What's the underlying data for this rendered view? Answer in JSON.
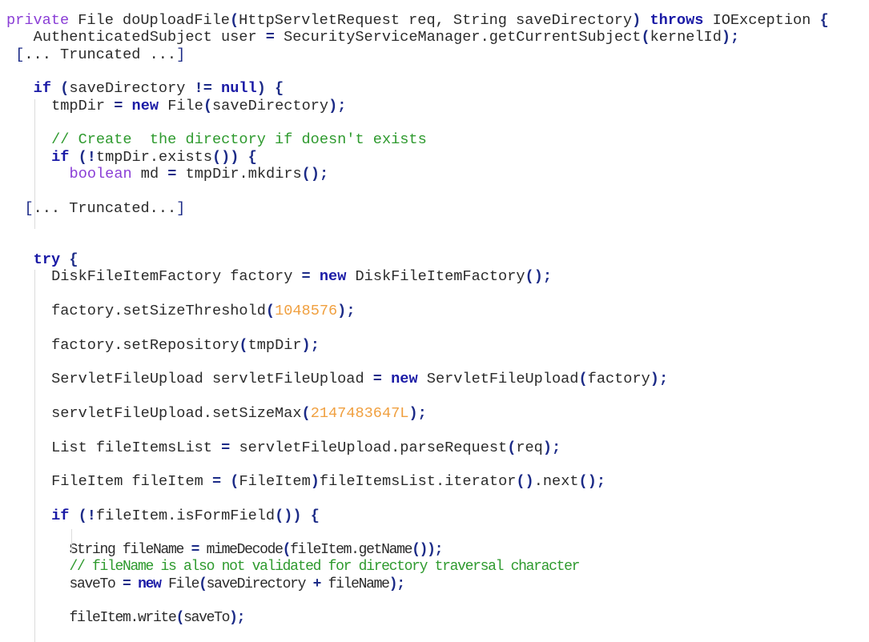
{
  "editor": {
    "language": "java",
    "colors": {
      "keyword": "#1a1aa6",
      "modifier": "#8a3ed6",
      "comment": "#2e9a2e",
      "number": "#f0a040",
      "punctuation": "#1c2b87",
      "text": "#2b2b2b",
      "background": "#ffffff"
    },
    "lines": [
      {
        "indent": 0,
        "tokens": [
          [
            "mod",
            "private"
          ],
          [
            "plain",
            " File doUploadFile"
          ],
          [
            "punc",
            "("
          ],
          [
            "plain",
            "HttpServletRequest req, String saveDirectory"
          ],
          [
            "punc",
            ")"
          ],
          [
            "plain",
            " "
          ],
          [
            "kw",
            "throws"
          ],
          [
            "plain",
            " IOException "
          ],
          [
            "punc",
            "{"
          ]
        ]
      },
      {
        "indent": 3,
        "tokens": [
          [
            "plain",
            "AuthenticatedSubject user "
          ],
          [
            "punc",
            "="
          ],
          [
            "plain",
            " SecurityServiceManager.getCurrentSubject"
          ],
          [
            "punc",
            "("
          ],
          [
            "plain",
            "kernelId"
          ],
          [
            "punc",
            ")"
          ],
          [
            "punc",
            ";"
          ]
        ]
      },
      {
        "indent": 1,
        "tokens": [
          [
            "trunc",
            "["
          ],
          [
            "plain",
            "... Truncated ..."
          ],
          [
            "trunc",
            "]"
          ]
        ]
      },
      {
        "indent": 0,
        "tokens": []
      },
      {
        "indent": 3,
        "tokens": [
          [
            "kw",
            "if"
          ],
          [
            "plain",
            " "
          ],
          [
            "punc",
            "("
          ],
          [
            "plain",
            "saveDirectory "
          ],
          [
            "punc",
            "!="
          ],
          [
            "plain",
            " "
          ],
          [
            "kw",
            "null"
          ],
          [
            "punc",
            ")"
          ],
          [
            "plain",
            " "
          ],
          [
            "punc",
            "{"
          ]
        ]
      },
      {
        "indent": 5,
        "tokens": [
          [
            "plain",
            "tmpDir "
          ],
          [
            "punc",
            "="
          ],
          [
            "plain",
            " "
          ],
          [
            "kw",
            "new"
          ],
          [
            "plain",
            " File"
          ],
          [
            "punc",
            "("
          ],
          [
            "plain",
            "saveDirectory"
          ],
          [
            "punc",
            ")"
          ],
          [
            "punc",
            ";"
          ]
        ]
      },
      {
        "indent": 0,
        "tokens": []
      },
      {
        "indent": 5,
        "tokens": [
          [
            "cmt",
            "// Create  the directory if doesn't exists"
          ]
        ]
      },
      {
        "indent": 5,
        "tokens": [
          [
            "kw",
            "if"
          ],
          [
            "plain",
            " "
          ],
          [
            "punc",
            "(!"
          ],
          [
            "plain",
            "tmpDir.exists"
          ],
          [
            "punc",
            "())"
          ],
          [
            "plain",
            " "
          ],
          [
            "punc",
            "{"
          ]
        ]
      },
      {
        "indent": 7,
        "tokens": [
          [
            "mod",
            "boolean"
          ],
          [
            "plain",
            " md "
          ],
          [
            "punc",
            "="
          ],
          [
            "plain",
            " tmpDir.mkdirs"
          ],
          [
            "punc",
            "()"
          ],
          [
            "punc",
            ";"
          ]
        ]
      },
      {
        "indent": 0,
        "tokens": []
      },
      {
        "indent": 2,
        "tokens": [
          [
            "trunc",
            "["
          ],
          [
            "plain",
            "... Truncated..."
          ],
          [
            "trunc",
            "]"
          ]
        ]
      },
      {
        "indent": 0,
        "tokens": []
      },
      {
        "indent": 0,
        "tokens": []
      },
      {
        "indent": 3,
        "tokens": [
          [
            "kw",
            "try"
          ],
          [
            "plain",
            " "
          ],
          [
            "punc",
            "{"
          ]
        ]
      },
      {
        "indent": 5,
        "tokens": [
          [
            "plain",
            "DiskFileItemFactory factory "
          ],
          [
            "punc",
            "="
          ],
          [
            "plain",
            " "
          ],
          [
            "kw",
            "new"
          ],
          [
            "plain",
            " DiskFileItemFactory"
          ],
          [
            "punc",
            "()"
          ],
          [
            "punc",
            ";"
          ]
        ]
      },
      {
        "indent": 0,
        "tokens": []
      },
      {
        "indent": 5,
        "tokens": [
          [
            "plain",
            "factory.setSizeThreshold"
          ],
          [
            "punc",
            "("
          ],
          [
            "num",
            "1048576"
          ],
          [
            "punc",
            ")"
          ],
          [
            "punc",
            ";"
          ]
        ]
      },
      {
        "indent": 0,
        "tokens": []
      },
      {
        "indent": 5,
        "tokens": [
          [
            "plain",
            "factory.setRepository"
          ],
          [
            "punc",
            "("
          ],
          [
            "plain",
            "tmpDir"
          ],
          [
            "punc",
            ")"
          ],
          [
            "punc",
            ";"
          ]
        ]
      },
      {
        "indent": 0,
        "tokens": []
      },
      {
        "indent": 5,
        "tokens": [
          [
            "plain",
            "ServletFileUpload servletFileUpload "
          ],
          [
            "punc",
            "="
          ],
          [
            "plain",
            " "
          ],
          [
            "kw",
            "new"
          ],
          [
            "plain",
            " ServletFileUpload"
          ],
          [
            "punc",
            "("
          ],
          [
            "plain",
            "factory"
          ],
          [
            "punc",
            ")"
          ],
          [
            "punc",
            ";"
          ]
        ]
      },
      {
        "indent": 0,
        "tokens": []
      },
      {
        "indent": 5,
        "tokens": [
          [
            "plain",
            "servletFileUpload.setSizeMax"
          ],
          [
            "punc",
            "("
          ],
          [
            "num",
            "2147483647L"
          ],
          [
            "punc",
            ")"
          ],
          [
            "punc",
            ";"
          ]
        ]
      },
      {
        "indent": 0,
        "tokens": []
      },
      {
        "indent": 5,
        "tokens": [
          [
            "plain",
            "List fileItemsList "
          ],
          [
            "punc",
            "="
          ],
          [
            "plain",
            " servletFileUpload.parseRequest"
          ],
          [
            "punc",
            "("
          ],
          [
            "plain",
            "req"
          ],
          [
            "punc",
            ")"
          ],
          [
            "punc",
            ";"
          ]
        ]
      },
      {
        "indent": 0,
        "tokens": []
      },
      {
        "indent": 5,
        "tokens": [
          [
            "plain",
            "FileItem fileItem "
          ],
          [
            "punc",
            "="
          ],
          [
            "plain",
            " "
          ],
          [
            "punc",
            "("
          ],
          [
            "plain",
            "FileItem"
          ],
          [
            "punc",
            ")"
          ],
          [
            "plain",
            "fileItemsList.iterator"
          ],
          [
            "punc",
            "()"
          ],
          [
            "plain",
            "."
          ],
          [
            "plain",
            "next"
          ],
          [
            "punc",
            "()"
          ],
          [
            "punc",
            ";"
          ]
        ]
      },
      {
        "indent": 0,
        "tokens": []
      },
      {
        "indent": 5,
        "tokens": [
          [
            "kw",
            "if"
          ],
          [
            "plain",
            " "
          ],
          [
            "punc",
            "(!"
          ],
          [
            "plain",
            "fileItem.isFormField"
          ],
          [
            "punc",
            "())"
          ],
          [
            "plain",
            " "
          ],
          [
            "punc",
            "{"
          ]
        ]
      },
      {
        "indent": 0,
        "tokens": []
      },
      {
        "indent": 7,
        "narrow": true,
        "tokens": [
          [
            "plain",
            "String fileName "
          ],
          [
            "punc",
            "="
          ],
          [
            "plain",
            " mimeDecode"
          ],
          [
            "punc",
            "("
          ],
          [
            "plain",
            "fileItem.getName"
          ],
          [
            "punc",
            "())"
          ],
          [
            "punc",
            ";"
          ]
        ]
      },
      {
        "indent": 7,
        "narrow": true,
        "tokens": [
          [
            "cmt",
            "// fileName is also not validated for directory traversal character"
          ]
        ]
      },
      {
        "indent": 7,
        "narrow": true,
        "tokens": [
          [
            "plain",
            "saveTo "
          ],
          [
            "punc",
            "="
          ],
          [
            "plain",
            " "
          ],
          [
            "kw",
            "new"
          ],
          [
            "plain",
            " File"
          ],
          [
            "punc",
            "("
          ],
          [
            "plain",
            "saveDirectory "
          ],
          [
            "punc",
            "+"
          ],
          [
            "plain",
            " fileName"
          ],
          [
            "punc",
            ")"
          ],
          [
            "punc",
            ";"
          ]
        ]
      },
      {
        "indent": 0,
        "tokens": []
      },
      {
        "indent": 7,
        "narrow": true,
        "tokens": [
          [
            "plain",
            "fileItem.write"
          ],
          [
            "punc",
            "("
          ],
          [
            "plain",
            "saveTo"
          ],
          [
            "punc",
            ")"
          ],
          [
            "punc",
            ";"
          ]
        ]
      }
    ]
  }
}
